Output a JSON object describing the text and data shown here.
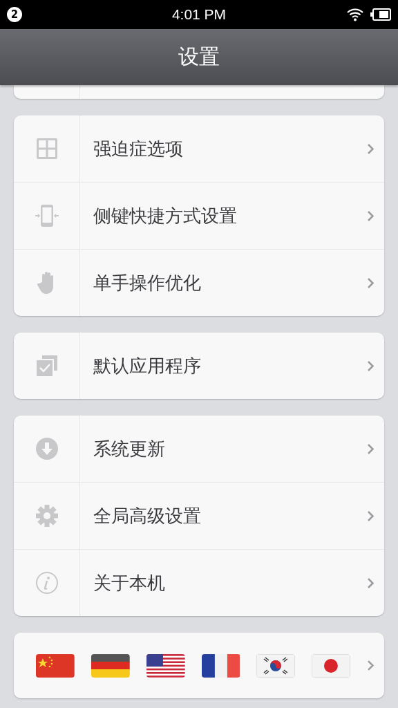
{
  "status_bar": {
    "notification_count": "2",
    "time": "4:01 PM"
  },
  "header": {
    "title": "设置"
  },
  "groups": [
    {
      "items": [
        {
          "kind": "grid",
          "label": "强迫症选项"
        },
        {
          "kind": "phone",
          "label": "侧键快捷方式设置"
        },
        {
          "kind": "hand",
          "label": "单手操作优化"
        }
      ]
    },
    {
      "items": [
        {
          "kind": "check",
          "label": "默认应用程序"
        }
      ]
    },
    {
      "items": [
        {
          "kind": "download",
          "label": "系统更新"
        },
        {
          "kind": "gear",
          "label": "全局高级设置"
        },
        {
          "kind": "info",
          "label": "关于本机"
        }
      ]
    }
  ],
  "languages": [
    {
      "kind": "cn"
    },
    {
      "kind": "de"
    },
    {
      "kind": "us"
    },
    {
      "kind": "fr"
    },
    {
      "kind": "kr"
    },
    {
      "kind": "jp"
    }
  ]
}
